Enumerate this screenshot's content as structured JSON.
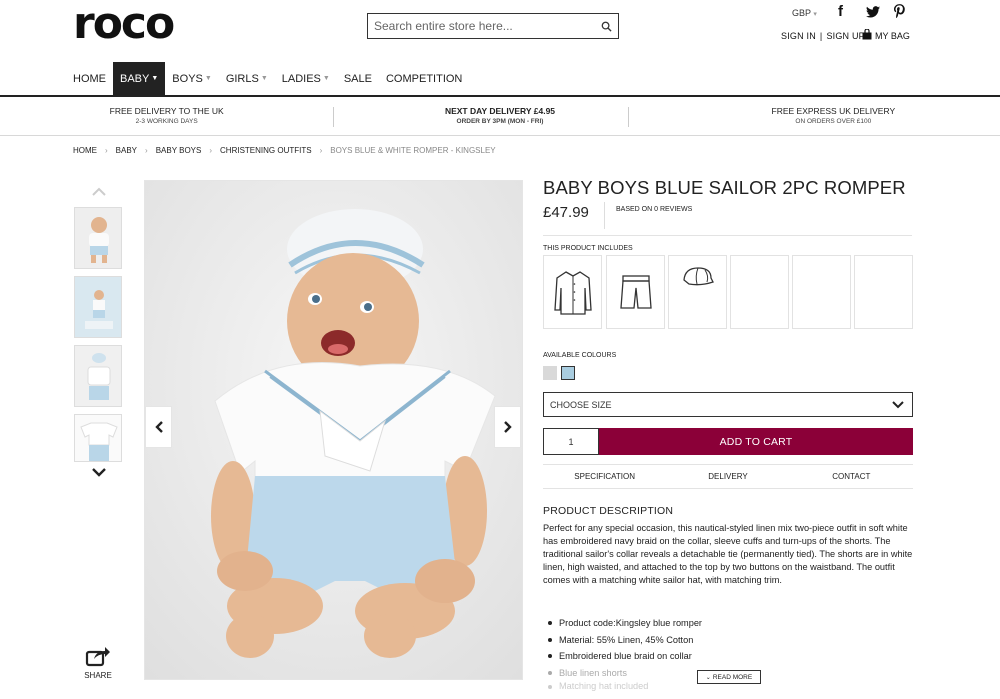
{
  "header": {
    "logo": "roco",
    "search_placeholder": "Search entire store here...",
    "currency": "GBP",
    "social": [
      "f",
      "twitter",
      "pinterest"
    ],
    "sign_in": "SIGN IN",
    "account_sep": "|",
    "sign_up": "SIGN UP",
    "bag": "MY BAG"
  },
  "nav": [
    {
      "label": "HOME",
      "has_caret": false
    },
    {
      "label": "BABY",
      "has_caret": true,
      "active": true
    },
    {
      "label": "BOYS",
      "has_caret": true
    },
    {
      "label": "GIRLS",
      "has_caret": true
    },
    {
      "label": "LADIES",
      "has_caret": true
    },
    {
      "label": "SALE",
      "has_caret": false
    },
    {
      "label": "COMPETITION",
      "has_caret": false
    }
  ],
  "delivery": [
    {
      "title": "FREE DELIVERY TO THE UK",
      "sub": "2-3 WORKING DAYS"
    },
    {
      "title": "NEXT DAY DELIVERY £4.95",
      "sub": "ORDER BY 3PM (MON - FRI)"
    },
    {
      "title": "FREE EXPRESS UK DELIVERY",
      "sub": "ON ORDERS OVER £100"
    }
  ],
  "breadcrumb": [
    "HOME",
    "BABY",
    "BABY BOYS",
    "CHRISTENING OUTFITS",
    "BOYS BLUE & WHITE ROMPER - KINGSLEY"
  ],
  "gallery": {
    "share_label": "SHARE"
  },
  "product": {
    "title": "BABY BOYS BLUE SAILOR 2PC ROMPER",
    "price": "£47.99",
    "reviews": "BASED ON 0 REVIEWS",
    "includes_label": "THIS PRODUCT INCLUDES",
    "includes_icons": [
      "shirt-icon",
      "shorts-icon",
      "cap-icon"
    ],
    "colours_label": "AVAILABLE COLOURS",
    "colours": [
      "#d9d9d9",
      "#a9cde0"
    ],
    "size_placeholder": "CHOOSE SIZE",
    "quantity": "1",
    "add_to_cart": "ADD TO CART",
    "cart_color": "#8b0038",
    "tabs": [
      "SPECIFICATION",
      "DELIVERY",
      "CONTACT"
    ],
    "desc_title": "PRODUCT DESCRIPTION",
    "description": "Perfect for any special occasion, this nautical-styled linen mix two-piece outfit in soft white has embroidered navy braid on the collar, sleeve cuffs and turn-ups of the shorts. The traditional sailor's collar reveals a detachable tie (permanently tied). The shorts are in white linen, high waisted, and attached to the top by two buttons on the waistband. The outfit comes with a matching white sailor hat, with matching trim.",
    "bullets": [
      "Product code:Kingsley blue romper",
      "Material: 55% Linen, 45% Cotton",
      "Embroidered blue braid on collar",
      "Blue linen shorts",
      "Matching hat included"
    ],
    "read_more": "READ MORE"
  }
}
